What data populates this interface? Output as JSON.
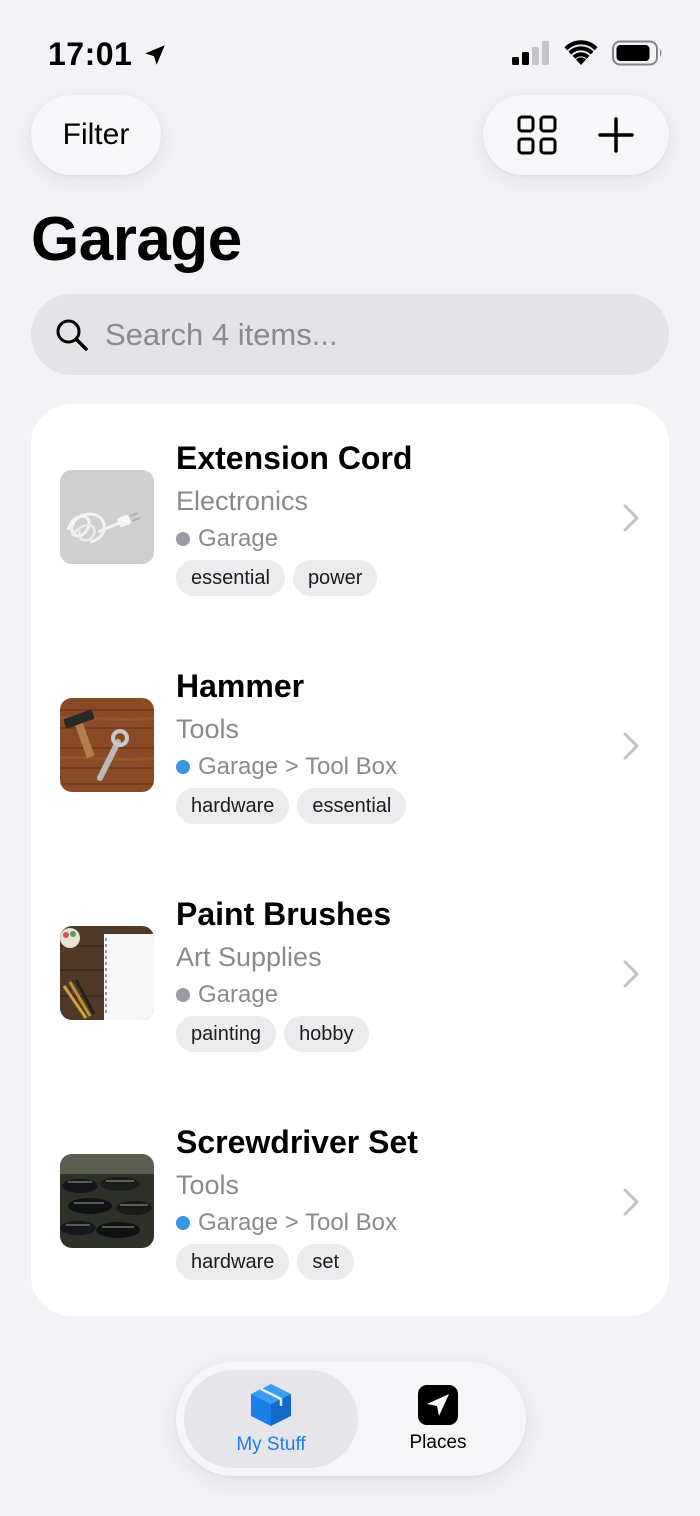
{
  "status_bar": {
    "time": "17:01"
  },
  "toolbar": {
    "filter_label": "Filter"
  },
  "page": {
    "title": "Garage"
  },
  "search": {
    "placeholder": "Search 4 items..."
  },
  "items": [
    {
      "name": "Extension Cord",
      "category": "Electronics",
      "location": "Garage",
      "location_color": "#9b9ba7",
      "tags": [
        "essential",
        "power"
      ]
    },
    {
      "name": "Hammer",
      "category": "Tools",
      "location": "Garage > Tool Box",
      "location_color": "#3a95e0",
      "tags": [
        "hardware",
        "essential"
      ]
    },
    {
      "name": "Paint Brushes",
      "category": "Art Supplies",
      "location": "Garage",
      "location_color": "#9b9ba7",
      "tags": [
        "painting",
        "hobby"
      ]
    },
    {
      "name": "Screwdriver Set",
      "category": "Tools",
      "location": "Garage > Tool Box",
      "location_color": "#3a95e0",
      "tags": [
        "hardware",
        "set"
      ]
    }
  ],
  "tabbar": {
    "tabs": [
      {
        "label": "My Stuff",
        "icon": "cube-icon",
        "active": true,
        "color": "#1a7ee8"
      },
      {
        "label": "Places",
        "icon": "location-arrow-icon",
        "active": false,
        "color": "#000000"
      }
    ]
  }
}
